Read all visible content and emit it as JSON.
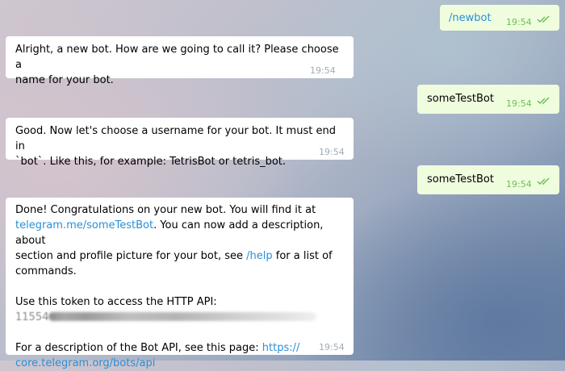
{
  "messages": {
    "m1": {
      "text": "/newbot",
      "time": "19:54"
    },
    "m2": {
      "line1": "Alright, a new bot. How are we going to call it? Please choose a",
      "line2": "name for your bot.",
      "time": "19:54"
    },
    "m3": {
      "text": "someTestBot",
      "time": "19:54"
    },
    "m4": {
      "line1": "Good. Now let's choose a username for your bot. It must end in",
      "line2": "`bot`. Like this, for example: TetrisBot or tetris_bot.",
      "time": "19:54"
    },
    "m5": {
      "text": "someTestBot",
      "time": "19:54"
    },
    "m6": {
      "l1": "Done! Congratulations on your new bot. You will find it at",
      "link1": "telegram.me/someTestBot",
      "l2_rest": ". You can now add a description, about",
      "l3a": "section and profile picture for your bot, see ",
      "link_help": "/help",
      "l3b": " for a list of",
      "l4": "commands.",
      "token_label": "Use this token to access the HTTP API:",
      "token_prefix": "11554",
      "l_api": "For a description of the Bot API, see this page: ",
      "link_api1": "https://",
      "link_api2": "core.telegram.org/bots/api",
      "time": "19:54"
    }
  },
  "colors": {
    "incoming": "#ffffff",
    "outgoing": "#effdde",
    "link": "#2a8fd6",
    "check": "#6cbf55"
  },
  "icons": {
    "read_status": "double-check-icon"
  }
}
